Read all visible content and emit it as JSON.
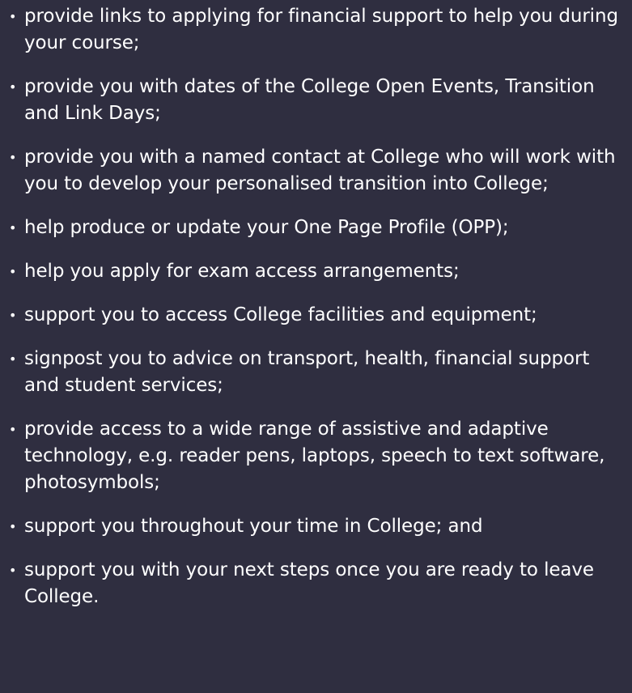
{
  "support_items": [
    "provide links to applying for financial support to help you during your course;",
    "provide you with dates of the College Open Events, Transition and Link Days;",
    "provide you with a named contact at College who will work with you to develop your personalised transition into College;",
    "help produce or update your One Page Profile (OPP);",
    "help you apply for exam access arrangements;",
    "support you to access College facilities and equipment;",
    "signpost you to advice on transport, health, financial support and student services;",
    "provide access to a wide range of assistive and adaptive technology, e.g. reader pens, laptops, speech to text software, photosymbols;",
    "support you throughout your time in College; and",
    "support you with your next steps once you are ready to leave College."
  ],
  "bullet_glyph": "•",
  "colors": {
    "background": "#2f2e40",
    "text": "#ffffff"
  }
}
